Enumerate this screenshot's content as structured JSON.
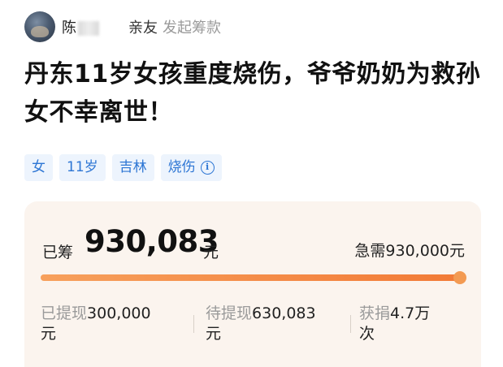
{
  "header": {
    "author_name": "陈",
    "relation": "亲友",
    "relation_sub": "发起筹款"
  },
  "title": "丹东11岁女孩重度烧伤，爷爷奶奶为救孙女不幸离世！",
  "tags": [
    "女",
    "11岁",
    "吉林",
    "烧伤"
  ],
  "funding": {
    "raised_label": "已筹",
    "raised_value": "930,083",
    "raised_unit": "元",
    "target_text": "急需930,000元",
    "progress_fraction": 1.0,
    "accent_color": "#f27a36"
  },
  "stats": {
    "withdrawn_label": "已提现",
    "withdrawn_value": "300,000",
    "withdrawn_unit": "元",
    "pending_label": "待提现",
    "pending_value": "630,083",
    "pending_unit": "元",
    "donors_label": "获捐",
    "donors_value": "4.7万",
    "donors_unit": "次"
  }
}
